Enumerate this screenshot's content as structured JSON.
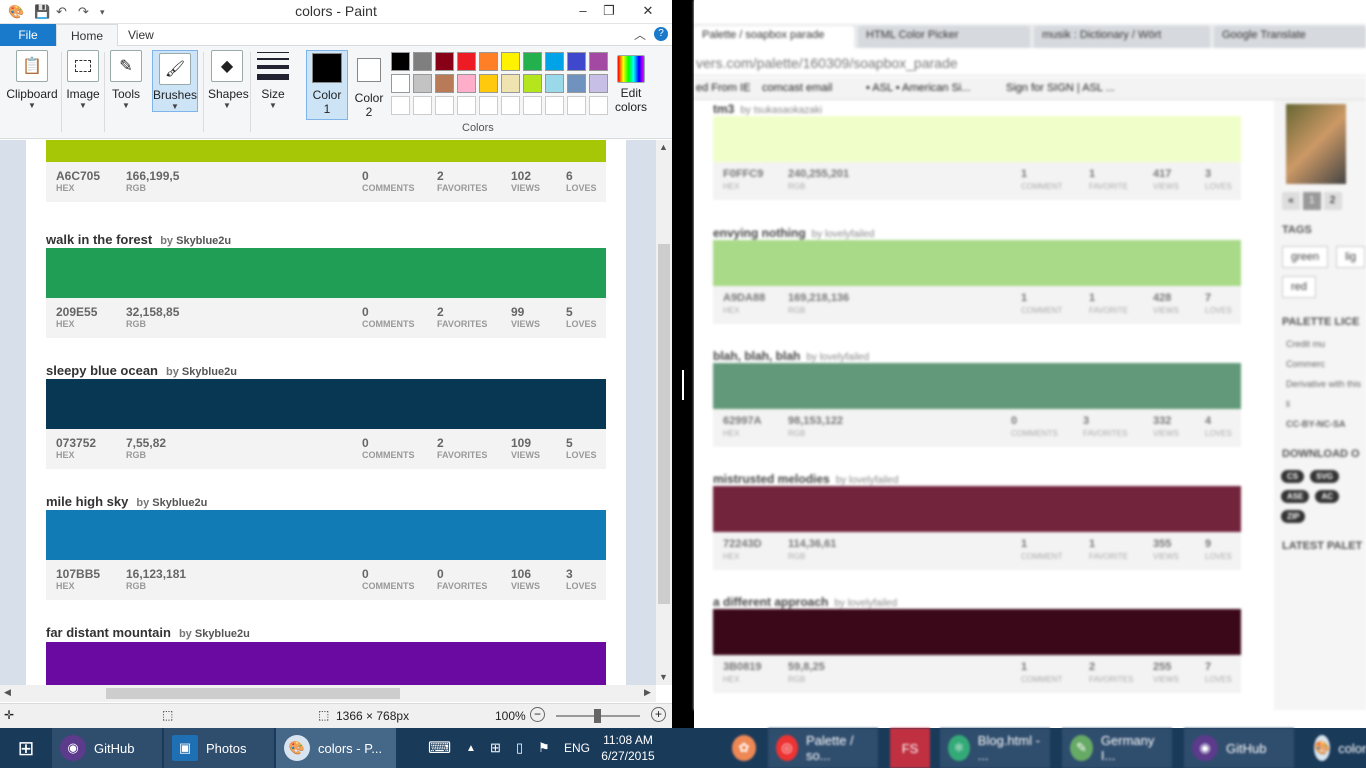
{
  "paint": {
    "title": "colors - Paint",
    "tabs": {
      "file": "File",
      "home": "Home",
      "view": "View"
    },
    "ribbon": {
      "clipboard": "Clipboard",
      "image": "Image",
      "tools": "Tools",
      "brushes": "Brushes",
      "shapes": "Shapes",
      "size": "Size",
      "color1_l1": "Color",
      "color1_l2": "1",
      "color2_l1": "Color",
      "color2_l2": "2",
      "colors_group": "Colors",
      "edit_l1": "Edit",
      "edit_l2": "colors"
    },
    "swatches_row1": [
      "#000000",
      "#7f7f7f",
      "#880015",
      "#ed1c24",
      "#ff7f27",
      "#fff200",
      "#22b14c",
      "#00a2e8",
      "#3f48cc",
      "#a349a4"
    ],
    "swatches_row2": [
      "#ffffff",
      "#c3c3c3",
      "#b97a57",
      "#ffaec9",
      "#ffc90e",
      "#efe4b0",
      "#b5e61d",
      "#99d9ea",
      "#7092be",
      "#c8bfe7"
    ],
    "labels": {
      "hex": "HEX",
      "rgb": "RGB",
      "comments": "COMMENTS",
      "favorites": "FAVORITES",
      "views": "VIEWS",
      "loves": "LOVES"
    },
    "palettes": [
      {
        "name": "",
        "by": "",
        "author": "",
        "color": "#a6c705",
        "hex": "A6C705",
        "rgb": "166,199,5",
        "comments": "0",
        "favorites": "2",
        "views": "102",
        "loves": "6"
      },
      {
        "name": "walk in the forest",
        "by": "by",
        "author": "Skyblue2u",
        "color": "#209e55",
        "hex": "209E55",
        "rgb": "32,158,85",
        "comments": "0",
        "favorites": "2",
        "views": "99",
        "loves": "5"
      },
      {
        "name": "sleepy blue ocean",
        "by": "by",
        "author": "Skyblue2u",
        "color": "#073752",
        "hex": "073752",
        "rgb": "7,55,82",
        "comments": "0",
        "favorites": "2",
        "views": "109",
        "loves": "5"
      },
      {
        "name": "mile high sky",
        "by": "by",
        "author": "Skyblue2u",
        "color": "#107bb5",
        "hex": "107BB5",
        "rgb": "16,123,181",
        "comments": "0",
        "favorites": "0",
        "views": "106",
        "loves": "3"
      },
      {
        "name": "far distant mountain",
        "by": "by",
        "author": "Skyblue2u",
        "color": "#6a0aa0"
      }
    ],
    "status": {
      "dimensions": "1366 × 768px",
      "zoom": "100%"
    }
  },
  "browser": {
    "tabs": [
      "Palette / soapbox parade",
      "HTML Color Picker",
      "musik : Dictionary / Wört",
      "Google Translate"
    ],
    "url": "vers.com/palette/160309/soapbox_parade",
    "bookmarks": [
      "ed From IE",
      "comcast email",
      "• ASL • American Si...",
      "Sign for SIGN | ASL ..."
    ],
    "labels": {
      "hex": "HEX",
      "rgb": "RGB",
      "comment": "COMMENT",
      "comments": "COMMENTS",
      "favorite": "FAVORITE",
      "favorites": "FAVORITES",
      "views": "VIEWS",
      "loves": "LOVES"
    },
    "palettes": [
      {
        "name": "tm3",
        "by": "by",
        "author": "tsukasaokazaki",
        "color": "#f0ffc9",
        "hex": "F0FFC9",
        "rgb": "240,255,201",
        "comments": "1",
        "clabel": "COMMENT",
        "favorites": "1",
        "flabel": "FAVORITE",
        "views": "417",
        "loves": "3"
      },
      {
        "name": "envying nothing",
        "by": "by",
        "author": "lovelyfailed",
        "color": "#a9da88",
        "hex": "A9DA88",
        "rgb": "169,218,136",
        "comments": "1",
        "clabel": "COMMENT",
        "favorites": "1",
        "flabel": "FAVORITE",
        "views": "428",
        "loves": "7"
      },
      {
        "name": "blah, blah, blah",
        "by": "by",
        "author": "lovelyfailed",
        "color": "#62997a",
        "hex": "62997A",
        "rgb": "98,153,122",
        "comments": "0",
        "clabel": "COMMENTS",
        "favorites": "3",
        "flabel": "FAVORITES",
        "views": "332",
        "loves": "4"
      },
      {
        "name": "mistrusted melodies",
        "by": "by",
        "author": "lovelyfailed",
        "color": "#72243d",
        "hex": "72243D",
        "rgb": "114,36,61",
        "comments": "1",
        "clabel": "COMMENT",
        "favorites": "1",
        "flabel": "FAVORITE",
        "views": "355",
        "loves": "9"
      },
      {
        "name": "a different approach",
        "by": "by",
        "author": "lovelyfailed",
        "color": "#3b0819",
        "hex": "3B0819",
        "rgb": "59,8,25",
        "comments": "1",
        "clabel": "COMMENT",
        "favorites": "2",
        "flabel": "FAVORITES",
        "views": "255",
        "loves": "7"
      }
    ],
    "sidebar": {
      "pagination": [
        "«",
        "1",
        "2"
      ],
      "tags_title": "TAGS",
      "tags": [
        "green",
        "lig",
        "red"
      ],
      "license_title": "PALETTE LICE",
      "license_items": [
        "Credit mu",
        "Commerc",
        "Derivative with this li"
      ],
      "license_code": "CC-BY-NC-SA",
      "download_title": "DOWNLOAD O",
      "downloads": [
        "CS",
        "SVG",
        "ASE",
        "AC",
        "ZIP"
      ],
      "latest_title": "LATEST PALET"
    }
  },
  "taskbar": {
    "items": [
      "GitHub",
      "Photos",
      "colors - P...",
      "Palette / so...",
      "FS",
      "Blog.html - ...",
      "Germany I...",
      "GitHub",
      "colors"
    ],
    "lang": "ENG",
    "time": "11:08 AM",
    "date": "6/27/2015"
  }
}
